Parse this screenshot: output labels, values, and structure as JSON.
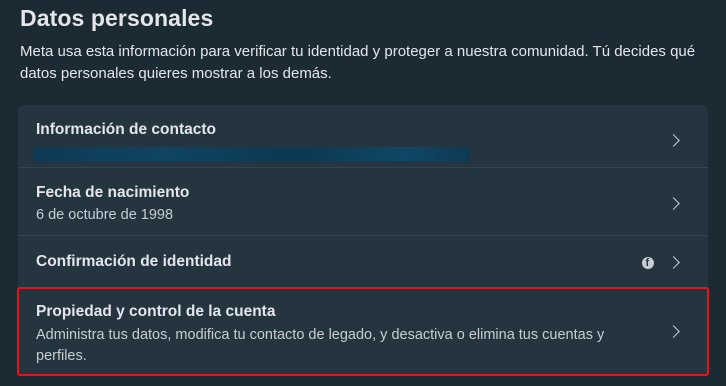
{
  "header": {
    "title": "Datos personales",
    "description": "Meta usa esta información para verificar tu identidad y proteger a nuestra comunidad. Tú decides qué datos personales quieres mostrar a los demás."
  },
  "rows": [
    {
      "title": "Información de contacto",
      "subtitle_redacted": true
    },
    {
      "title": "Fecha de nacimiento",
      "subtitle": "6 de octubre de 1998"
    },
    {
      "title": "Confirmación de identidad",
      "icon": "facebook-icon"
    },
    {
      "title": "Propiedad y control de la cuenta",
      "description": "Administra tus datos, modifica tu contacto de legado, y desactiva o elimina tus cuentas y perfiles.",
      "highlighted": true
    }
  ],
  "colors": {
    "background": "#1c2b33",
    "card": "#243540",
    "highlight_border": "#e5141c"
  }
}
